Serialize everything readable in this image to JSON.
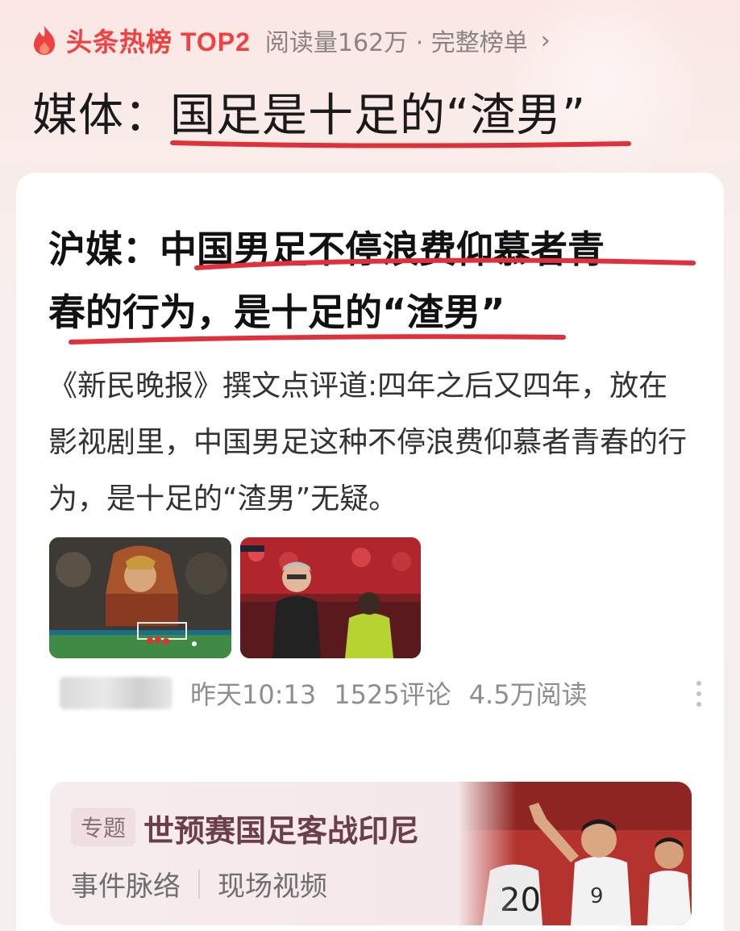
{
  "hot_list": {
    "label": "头条热榜 TOP2",
    "meta": "阅读量162万 · 完整榜单",
    "arrow": "›"
  },
  "topic": {
    "title": "媒体：国足是十足的“渣男”"
  },
  "article": {
    "headline_line1": "沪媒：中国男足不停浪费仰慕者青",
    "headline_line2": "春的行为，是十足的“渣男”",
    "summary": "《新民晚报》撰文点评道:四年之后又四年，放在影视剧里，中国男足这种不停浪费仰慕者青春的行为，是十足的“渣男”无疑。",
    "time": "昨天10:13",
    "comments": "1525评论",
    "reads": "4.5万阅读"
  },
  "special": {
    "tag": "专题",
    "title": "世预赛国足客战印尼",
    "links": [
      "事件脉络",
      "现场视频"
    ]
  },
  "colors": {
    "brand_red": "#f04142",
    "underline_red": "#e0303a"
  }
}
